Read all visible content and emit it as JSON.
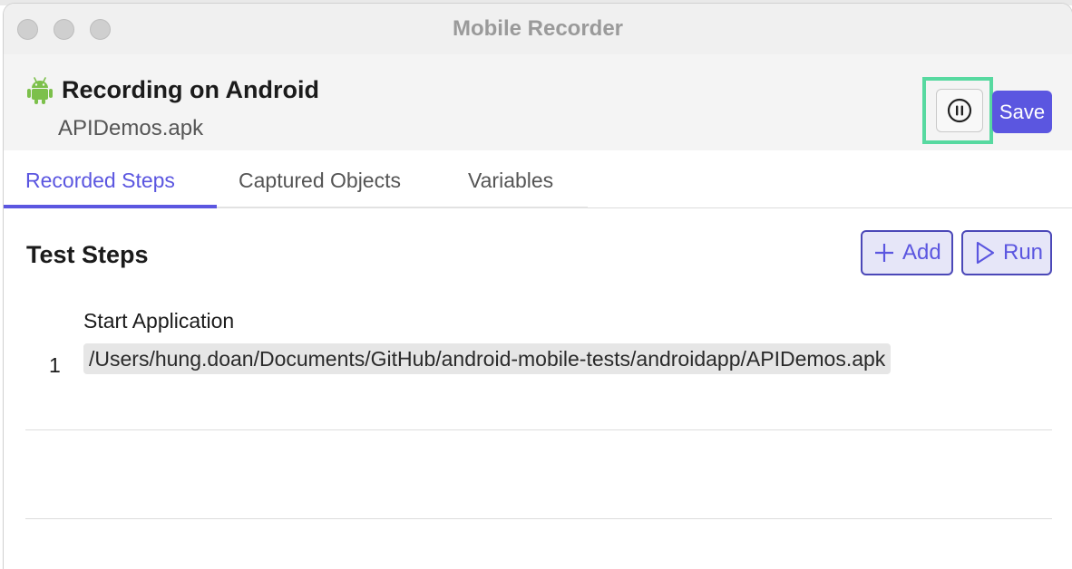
{
  "window": {
    "title": "Mobile Recorder"
  },
  "header": {
    "title": "Recording on Android",
    "subtitle": "APIDemos.apk",
    "platform_icon": "android-icon",
    "pause_icon": "pause-circle-icon",
    "save_label": "Save"
  },
  "tabs": [
    {
      "label": "Recorded Steps",
      "active": true
    },
    {
      "label": "Captured Objects",
      "active": false
    },
    {
      "label": "Variables",
      "active": false
    }
  ],
  "steps_section": {
    "title": "Test Steps",
    "add_label": "Add",
    "run_label": "Run",
    "add_icon": "plus-icon",
    "run_icon": "play-icon"
  },
  "steps": [
    {
      "number": "1",
      "name": "Start Application",
      "value": "/Users/hung.doan/Documents/GitHub/android-mobile-tests/androidapp/APIDemos.apk"
    }
  ],
  "colors": {
    "accent": "#5b56e0",
    "highlight": "#57d9a0",
    "android_green": "#7cc04b"
  }
}
